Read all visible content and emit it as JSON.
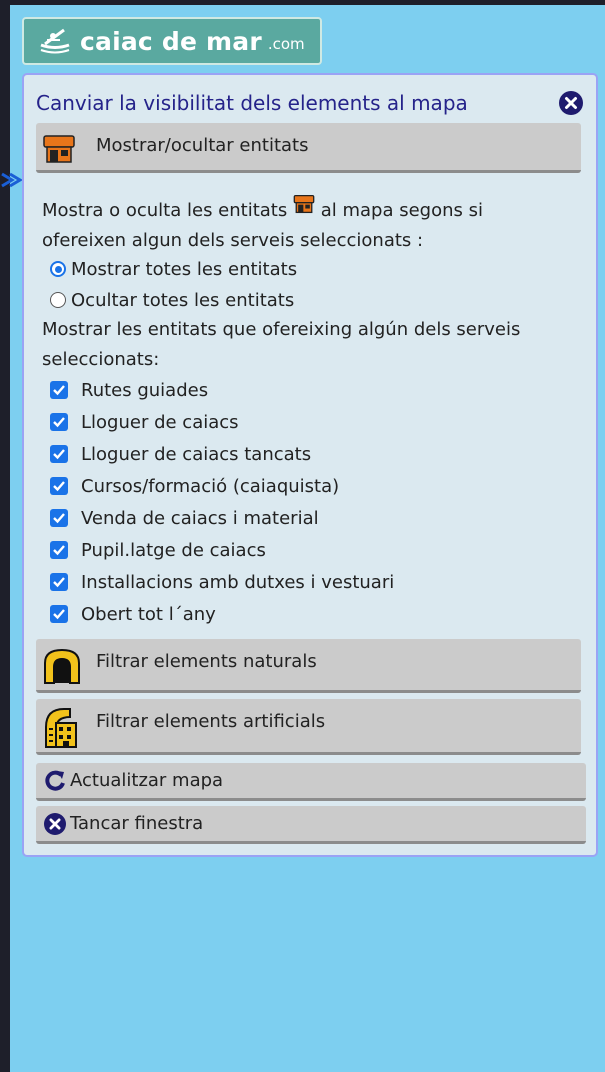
{
  "logo": {
    "main": "caiac de mar",
    "tld": ".com"
  },
  "panel": {
    "title": "Canviar la visibilitat dels elements al mapa",
    "entitats_section": {
      "label": "Mostrar/ocultar entitats",
      "desc_prefix": "Mostra o oculta les entitats",
      "desc_suffix": "al mapa segons si",
      "desc_line2": "ofereixen algun dels serveis seleccionats :",
      "radios": [
        {
          "label": "Mostrar totes les entitats",
          "checked": true
        },
        {
          "label": "Ocultar totes les entitats",
          "checked": false
        }
      ],
      "filter_line1": "Mostrar les entitats que ofereixing algún dels serveis",
      "filter_line2": "seleccionats:",
      "services": [
        {
          "label": "Rutes guiades",
          "checked": true
        },
        {
          "label": "Lloguer de caiacs",
          "checked": true
        },
        {
          "label": "Lloguer de caiacs tancats",
          "checked": true
        },
        {
          "label": "Cursos/formació (caiaquista)",
          "checked": true
        },
        {
          "label": "Venda de caiacs i material",
          "checked": true
        },
        {
          "label": "Pupil.latge de caiacs",
          "checked": true
        },
        {
          "label": "Installacions amb dutxes i vestuari",
          "checked": true
        },
        {
          "label": "Obert tot l´any",
          "checked": true
        }
      ]
    },
    "naturals_label": "Filtrar elements naturals",
    "artificials_label": "Filtrar elements artificials",
    "update_label": "Actualitzar mapa",
    "close_label": "Tancar finestra"
  },
  "colors": {
    "background": "#7dcff0",
    "panel": "#dbe9f0",
    "title": "#25238a",
    "checkbox": "#1a73e8",
    "shop_icon": "#e8751a",
    "close_icon": "#1f1b6e"
  },
  "icons": [
    "kayak-logo-icon",
    "close-icon",
    "shop-icon",
    "arch-icon",
    "building-icon",
    "refresh-icon",
    "arrow-icon"
  ]
}
